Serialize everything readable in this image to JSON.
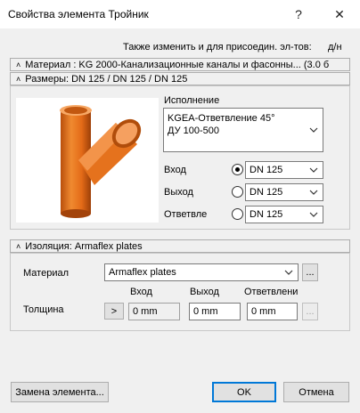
{
  "window": {
    "title": "Свойства элемента Тройник",
    "help_glyph": "?",
    "close_glyph": "✕"
  },
  "top_label": "Также изменить и для присоедин. эл-тов:",
  "top_right_label": "д/н",
  "material_header": "Материал : KG 2000-Канализационные каналы и фасонны... (3.0 б",
  "sizes": {
    "header": "Размеры: DN 125 / DN 125 / DN 125",
    "variant_label": "Исполнение",
    "variant_value_line1": "KGEA-Ответвление 45°",
    "variant_value_line2": "ДУ 100-500",
    "rows": [
      {
        "label": "Вход",
        "value": "DN 125",
        "selected": true
      },
      {
        "label": "Выход",
        "value": "DN 125",
        "selected": false
      },
      {
        "label": "Ответвле",
        "value": "DN 125",
        "selected": false
      }
    ]
  },
  "insulation": {
    "header": "Изоляция: Armaflex plates",
    "material_label": "Материал",
    "material_value": "Armaflex plates",
    "browse": "...",
    "cols": [
      "Вход",
      "Выход",
      "Ответвлени"
    ],
    "thickness_label": "Толщина",
    "arrow": ">",
    "values": [
      "0 mm",
      "0 mm",
      "0 mm"
    ],
    "browse2": "..."
  },
  "buttons": {
    "replace": "Замена элемента...",
    "ok": "OK",
    "cancel": "Отмена"
  },
  "colors": {
    "pipe": "#e8721c",
    "accent": "#0078d7"
  }
}
